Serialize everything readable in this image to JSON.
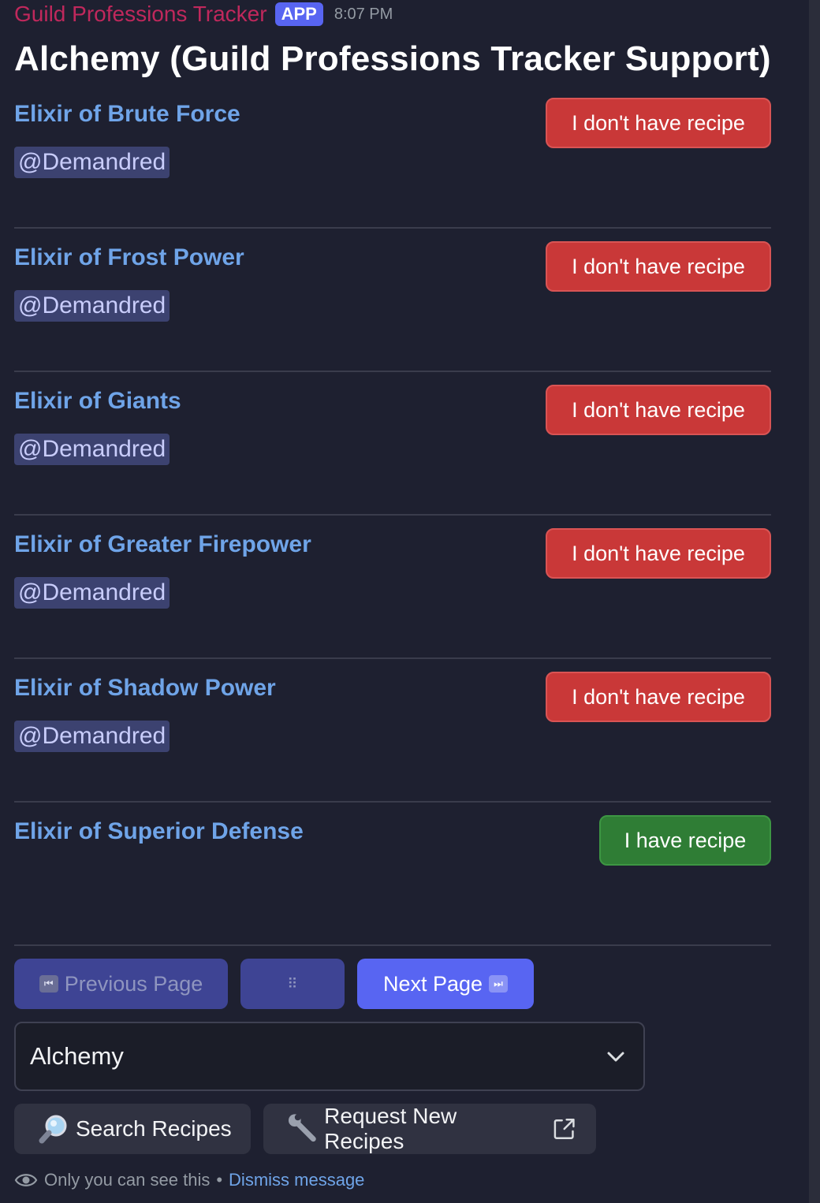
{
  "header": {
    "app_name": "Guild Professions Tracker",
    "badge": "APP",
    "timestamp": "8:07 PM"
  },
  "title": "Alchemy (Guild Professions Tracker Support)",
  "recipes": [
    {
      "name": "Elixir of Brute Force",
      "mention": "@Demandred",
      "button": "I don't have recipe",
      "status": "missing"
    },
    {
      "name": "Elixir of Frost Power",
      "mention": "@Demandred",
      "button": "I don't have recipe",
      "status": "missing"
    },
    {
      "name": "Elixir of Giants",
      "mention": "@Demandred",
      "button": "I don't have recipe",
      "status": "missing"
    },
    {
      "name": "Elixir of Greater Firepower",
      "mention": "@Demandred",
      "button": "I don't have recipe",
      "status": "missing"
    },
    {
      "name": "Elixir of Shadow Power",
      "mention": "@Demandred",
      "button": "I don't have recipe",
      "status": "missing"
    },
    {
      "name": "Elixir of Superior Defense",
      "mention": "",
      "button": "I have recipe",
      "status": "have"
    }
  ],
  "pager": {
    "previous_label": "Previous Page",
    "previous_icon": "⏮",
    "middle_icon": "⠿",
    "next_label": "Next Page",
    "next_icon": "⏭"
  },
  "select": {
    "value": "Alchemy"
  },
  "actions": {
    "search_label": "Search Recipes",
    "request_label": "Request New Recipes"
  },
  "footer": {
    "notice": "Only you can see this",
    "separator": "•",
    "dismiss_label": "Dismiss message"
  },
  "colors": {
    "background": "#1e2030",
    "link": "#6fa4e8",
    "danger": "#c93838",
    "success": "#2f7d35",
    "brand": "#5865f2",
    "app_name": "#c0285c"
  }
}
